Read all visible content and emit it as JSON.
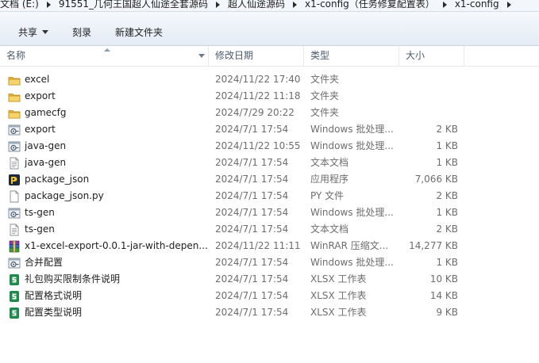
{
  "address_bar": {
    "crumbs": [
      "文档 (E:)",
      "91551_几何王国超人仙途全套源码",
      "超人仙途源码",
      "x1-config（任务修复配置表）",
      "x1-config"
    ]
  },
  "toolbar": {
    "share_label": "共享",
    "burn_label": "刻录",
    "new_folder_label": "新建文件夹"
  },
  "columns": {
    "name": "名称",
    "date": "修改日期",
    "type": "类型",
    "size": "大小"
  },
  "files": [
    {
      "name": "excel",
      "date": "2024/11/22 17:40",
      "type": "文件夹",
      "size": "",
      "icon": "folder-icon"
    },
    {
      "name": "export",
      "date": "2024/11/22 11:18",
      "type": "文件夹",
      "size": "",
      "icon": "folder-icon"
    },
    {
      "name": "gamecfg",
      "date": "2024/7/29 20:22",
      "type": "文件夹",
      "size": "",
      "icon": "folder-icon"
    },
    {
      "name": "export",
      "date": "2024/7/1 17:54",
      "type": "Windows 批处理...",
      "size": "2 KB",
      "icon": "batch-file-icon"
    },
    {
      "name": "java-gen",
      "date": "2024/11/22 10:55",
      "type": "Windows 批处理...",
      "size": "1 KB",
      "icon": "batch-file-icon"
    },
    {
      "name": "java-gen",
      "date": "2024/7/1 17:54",
      "type": "文本文档",
      "size": "1 KB",
      "icon": "text-file-icon"
    },
    {
      "name": "package_json",
      "date": "2024/7/1 17:54",
      "type": "应用程序",
      "size": "7,066 KB",
      "icon": "application-icon"
    },
    {
      "name": "package_json.py",
      "date": "2024/7/1 17:54",
      "type": "PY 文件",
      "size": "2 KB",
      "icon": "py-file-icon"
    },
    {
      "name": "ts-gen",
      "date": "2024/7/1 17:54",
      "type": "Windows 批处理...",
      "size": "1 KB",
      "icon": "batch-file-icon"
    },
    {
      "name": "ts-gen",
      "date": "2024/7/1 17:54",
      "type": "文本文档",
      "size": "2 KB",
      "icon": "text-file-icon"
    },
    {
      "name": "x1-excel-export-0.0.1-jar-with-depen...",
      "date": "2024/11/22 11:11",
      "type": "WinRAR 压缩文...",
      "size": "14,277 KB",
      "icon": "winrar-archive-icon"
    },
    {
      "name": "合并配置",
      "date": "2024/7/1 17:54",
      "type": "Windows 批处理...",
      "size": "1 KB",
      "icon": "batch-file-icon"
    },
    {
      "name": "礼包购买限制条件说明",
      "date": "2024/7/1 17:54",
      "type": "XLSX 工作表",
      "size": "10 KB",
      "icon": "xlsx-file-icon"
    },
    {
      "name": "配置格式说明",
      "date": "2024/7/1 17:54",
      "type": "XLSX 工作表",
      "size": "14 KB",
      "icon": "xlsx-file-icon"
    },
    {
      "name": "配置类型说明",
      "date": "2024/7/1 17:54",
      "type": "XLSX 工作表",
      "size": "9 KB",
      "icon": "xlsx-file-icon"
    }
  ]
}
